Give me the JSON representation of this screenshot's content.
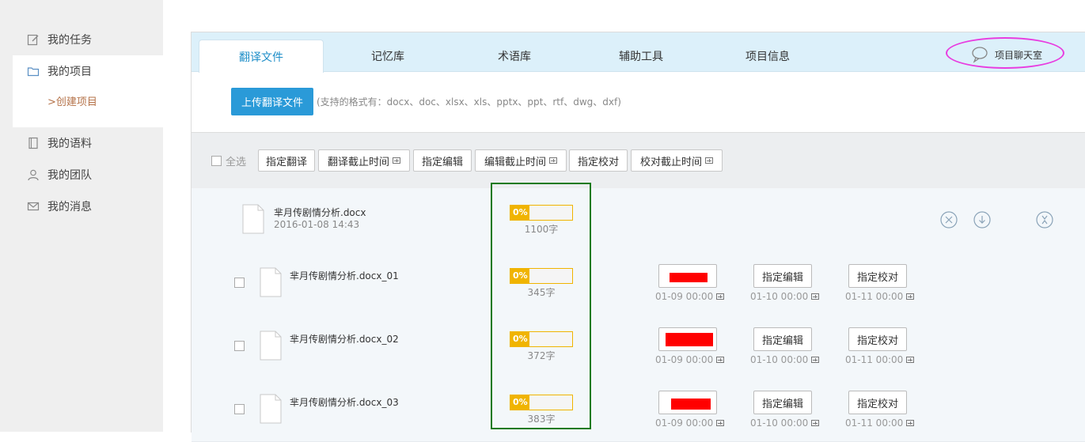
{
  "sidebar": {
    "items": [
      {
        "label": "我的任务",
        "icon": "edit-icon"
      },
      {
        "label": "我的项目",
        "icon": "folder-icon"
      },
      {
        "label": "我的语料",
        "icon": "book-icon"
      },
      {
        "label": "我的团队",
        "icon": "team-icon"
      },
      {
        "label": "我的消息",
        "icon": "mail-icon"
      }
    ],
    "sub_item": ">创建项目"
  },
  "tabs": [
    "翻译文件",
    "记忆库",
    "术语库",
    "辅助工具",
    "项目信息"
  ],
  "active_tab": "翻译文件",
  "chat_label": "项目聊天室",
  "upload": {
    "button": "上传翻译文件",
    "hint": "(支持的格式有：docx、doc、xlsx、xls、pptx、ppt、rtf、dwg、dxf)"
  },
  "toolbar": {
    "select_all": "全选",
    "buttons": [
      "指定翻译",
      "翻译截止时间",
      "指定编辑",
      "编辑截止时间",
      "指定校对",
      "校对截止时间"
    ]
  },
  "parent_file": {
    "name": "芈月传剧情分析.docx",
    "date": "2016-01-08 14:43",
    "progress": "0%",
    "progress_fraction": 0.0,
    "words": "1100字"
  },
  "files": [
    {
      "name": "芈月传剧情分析.docx_01",
      "progress": "0%",
      "progress_fraction": 0.0,
      "words": "345字",
      "edit_btn": "指定编辑",
      "proof_btn": "指定校对",
      "date_translate": "01-09 00:00",
      "date_edit": "01-10 00:00",
      "date_proof": "01-11 00:00"
    },
    {
      "name": "芈月传剧情分析.docx_02",
      "progress": "0%",
      "progress_fraction": 0.0,
      "words": "372字",
      "edit_btn": "指定编辑",
      "proof_btn": "指定校对",
      "date_translate": "01-09 00:00",
      "date_edit": "01-10 00:00",
      "date_proof": "01-11 00:00"
    },
    {
      "name": "芈月传剧情分析.docx_03",
      "progress": "0%",
      "progress_fraction": 0.0,
      "words": "383字",
      "edit_btn": "指定编辑",
      "proof_btn": "指定校对",
      "date_translate": "01-09 00:00",
      "date_edit": "01-10 00:00",
      "date_proof": "01-11 00:00"
    }
  ],
  "colors": {
    "accent": "#2a9ad8",
    "progress": "#f0b400",
    "sub_link": "#b5734a",
    "redaction": "#ff0000",
    "annotation_ring": "#e83ce0",
    "annotation_box": "#1a7a1a"
  }
}
